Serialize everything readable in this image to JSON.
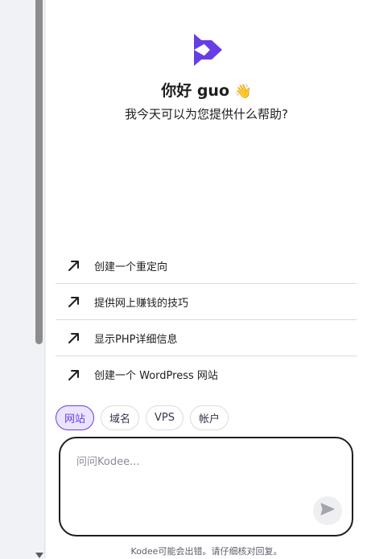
{
  "chat": {
    "greeting": "你好 guo",
    "greeting_emoji": "👋",
    "subtitle": "我今天可以为您提供什么帮助?",
    "suggestions": [
      {
        "label": "创建一个重定向",
        "icon": "arrow-up-right-icon"
      },
      {
        "label": "提供网上赚钱的技巧",
        "icon": "arrow-up-right-icon"
      },
      {
        "label": "显示PHP详细信息",
        "icon": "arrow-up-right-icon"
      },
      {
        "label": "创建一个 WordPress 网站",
        "icon": "arrow-up-right-icon"
      }
    ],
    "chips": [
      {
        "label": "网站",
        "active": true
      },
      {
        "label": "域名",
        "active": false
      },
      {
        "label": "VPS",
        "active": false
      },
      {
        "label": "帐户",
        "active": false
      }
    ],
    "input": {
      "placeholder": "问问Kodee...",
      "value": ""
    },
    "send_icon": "send-icon",
    "disclaimer": "Kodee可能会出错。请仔细核对回复。"
  },
  "colors": {
    "accent": "#673de6",
    "chip_active_bg": "#ebe4ff",
    "text": "#1d1e20",
    "muted": "#8a8c94"
  }
}
